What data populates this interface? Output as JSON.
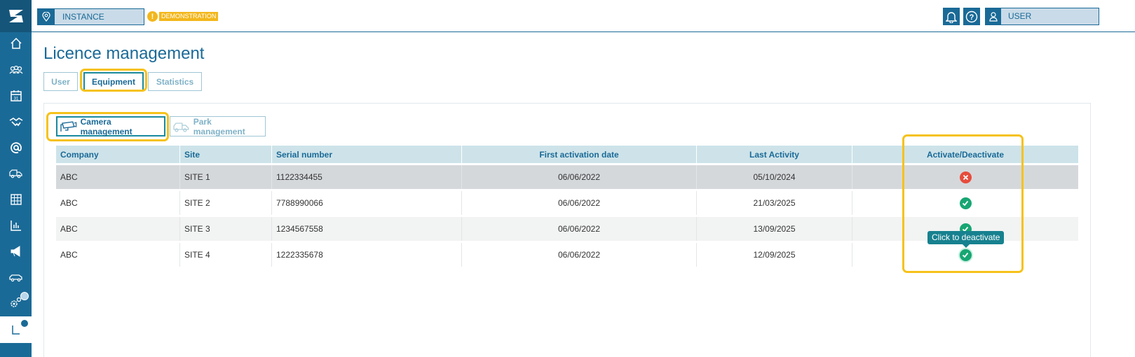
{
  "header": {
    "instance_label": "INSTANCE",
    "demo_label": "DEMONSTRATION",
    "user_label": "USER",
    "icons": [
      "location-icon",
      "bell-icon",
      "help-icon",
      "user-icon"
    ]
  },
  "sidebar": {
    "items": [
      "home",
      "groups",
      "calendar",
      "handshake",
      "email",
      "fleet",
      "table",
      "statistics",
      "announcements",
      "vehicle",
      "settings",
      "licences"
    ]
  },
  "page": {
    "title": "Licence management",
    "tabs": [
      {
        "label": "User",
        "active": false
      },
      {
        "label": "Equipment",
        "active": true
      },
      {
        "label": "Statistics",
        "active": false
      }
    ],
    "subtabs": [
      {
        "label": "Camera management",
        "active": true
      },
      {
        "label": "Park management",
        "active": false
      }
    ]
  },
  "table": {
    "columns": [
      "Company",
      "Site",
      "Serial number",
      "First activation date",
      "Last Activity",
      "Activate/Deactivate"
    ],
    "rows": [
      {
        "company": "ABC",
        "site": "SITE 1",
        "serial": "1122334455",
        "first_activation": "06/06/2022",
        "last_activity": "05/10/2024",
        "active": false
      },
      {
        "company": "ABC",
        "site": "SITE 2",
        "serial": "7788990066",
        "first_activation": "06/06/2022",
        "last_activity": "21/03/2025",
        "active": true
      },
      {
        "company": "ABC",
        "site": "SITE 3",
        "serial": "1234567558",
        "first_activation": "06/06/2022",
        "last_activity": "13/09/2025",
        "active": true
      },
      {
        "company": "ABC",
        "site": "SITE 4",
        "serial": "1222335678",
        "first_activation": "06/06/2022",
        "last_activity": "12/09/2025",
        "active": true
      }
    ]
  },
  "tooltip": "Click to deactivate",
  "colors": {
    "primary": "#1a6a97",
    "accent_highlight": "#f6c21a",
    "active_green": "#17a673",
    "inactive_red": "#e74c3c",
    "demo_badge": "#f3b71c"
  }
}
